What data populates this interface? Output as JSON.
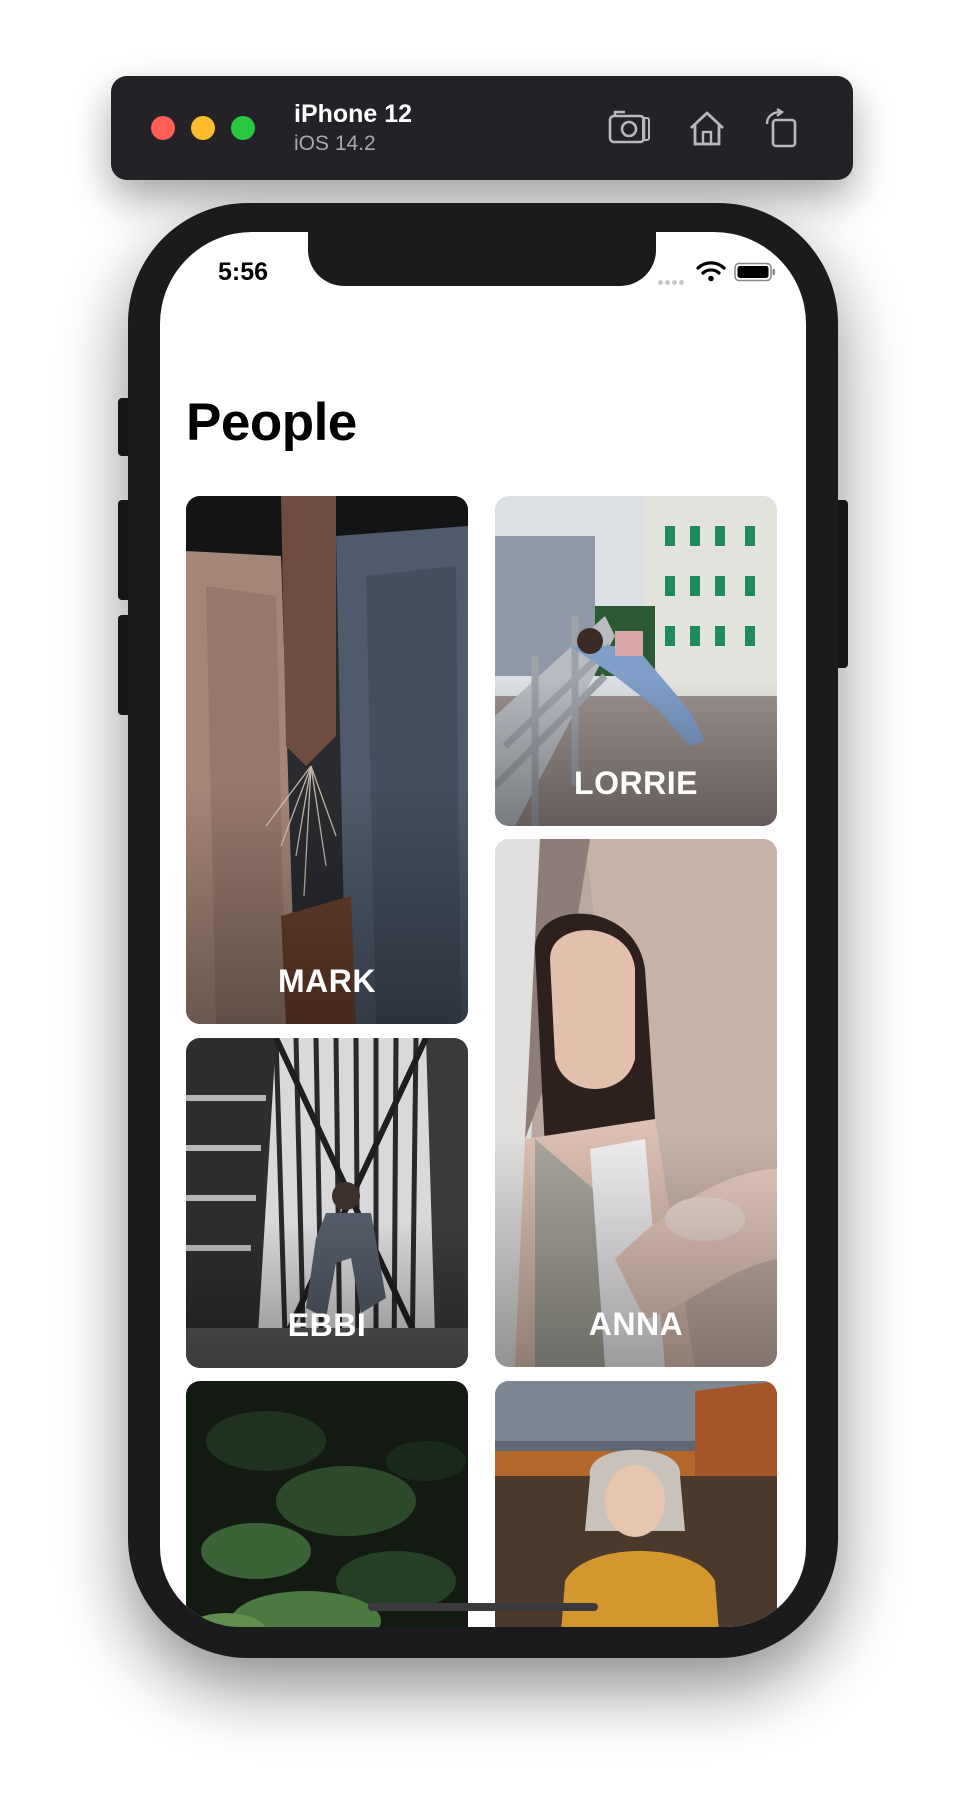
{
  "simulator": {
    "device_name": "iPhone 12",
    "os_version": "iOS 14.2",
    "buttons": [
      {
        "name": "screenshot-button",
        "icon": "camera-icon"
      },
      {
        "name": "home-button",
        "icon": "house-icon"
      },
      {
        "name": "rotate-button",
        "icon": "rotate-icon"
      }
    ],
    "colors": {
      "red": "#ff5f57",
      "yellow": "#febc2e",
      "green": "#28c840"
    }
  },
  "status_bar": {
    "time": "5:56"
  },
  "page": {
    "title": "People"
  },
  "people": [
    {
      "name": "MARK",
      "image": "couple-holding-hands-photo"
    },
    {
      "name": "LORRIE",
      "image": "woman-stretching-on-railing-photo"
    },
    {
      "name": "EBBI",
      "image": "man-sitting-on-stairs-photo"
    },
    {
      "name": "ANNA",
      "image": "woman-leaning-on-wall-photo"
    },
    {
      "name": "",
      "image": "forest-leaves-photo"
    },
    {
      "name": "",
      "image": "woman-in-field-photo"
    }
  ]
}
